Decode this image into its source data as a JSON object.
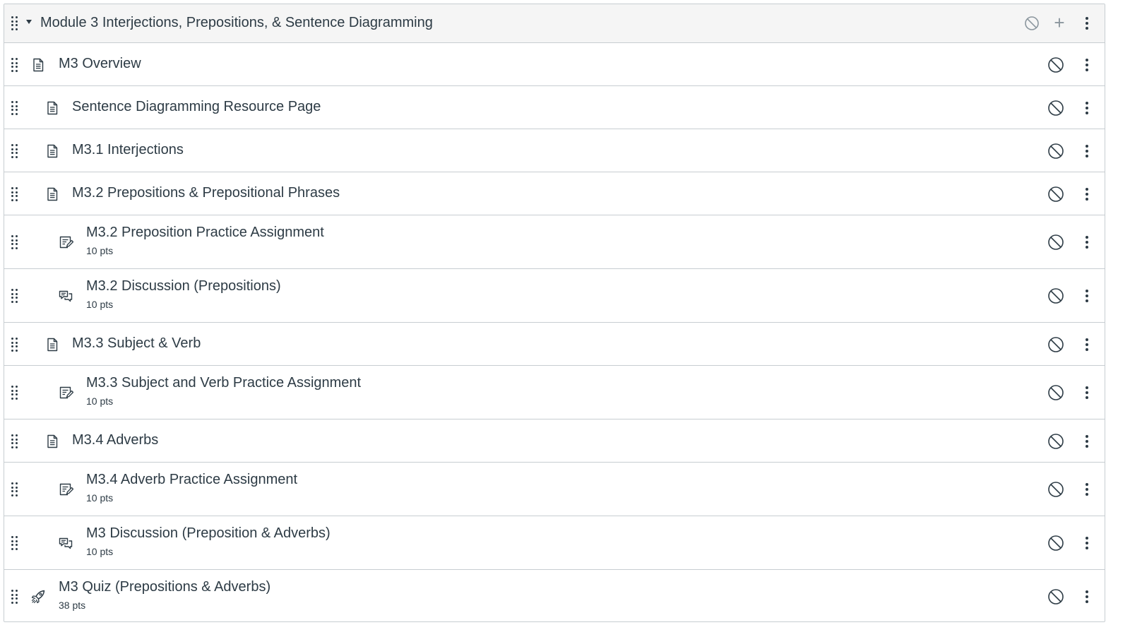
{
  "module": {
    "title": "Module 3 Interjections, Prepositions, & Sentence Diagramming",
    "add_symbol": "+"
  },
  "items": [
    {
      "title": "M3 Overview",
      "type": "page",
      "indent": 0
    },
    {
      "title": "Sentence Diagramming Resource Page",
      "type": "page",
      "indent": 1
    },
    {
      "title": "M3.1 Interjections",
      "type": "page",
      "indent": 1
    },
    {
      "title": "M3.2 Prepositions & Prepositional Phrases",
      "type": "page",
      "indent": 1
    },
    {
      "title": "M3.2 Preposition Practice Assignment",
      "type": "assignment",
      "indent": 2,
      "points": "10 pts"
    },
    {
      "title": "M3.2 Discussion (Prepositions)",
      "type": "discussion",
      "indent": 2,
      "points": "10 pts"
    },
    {
      "title": "M3.3 Subject & Verb",
      "type": "page",
      "indent": 1
    },
    {
      "title": "M3.3 Subject and Verb Practice Assignment",
      "type": "assignment",
      "indent": 2,
      "points": "10 pts"
    },
    {
      "title": "M3.4 Adverbs",
      "type": "page",
      "indent": 1
    },
    {
      "title": "M3.4 Adverb Practice Assignment",
      "type": "assignment",
      "indent": 2,
      "points": "10 pts"
    },
    {
      "title": "M3 Discussion (Preposition & Adverbs)",
      "type": "discussion",
      "indent": 2,
      "points": "10 pts"
    },
    {
      "title": "M3 Quiz (Prepositions & Adverbs)",
      "type": "quiz",
      "indent": 0,
      "points": "38 pts"
    }
  ],
  "colors": {
    "text": "#2d3b45",
    "header_bg": "#f5f5f5",
    "border": "#c7cdd1",
    "muted_icon": "#8b969e"
  }
}
